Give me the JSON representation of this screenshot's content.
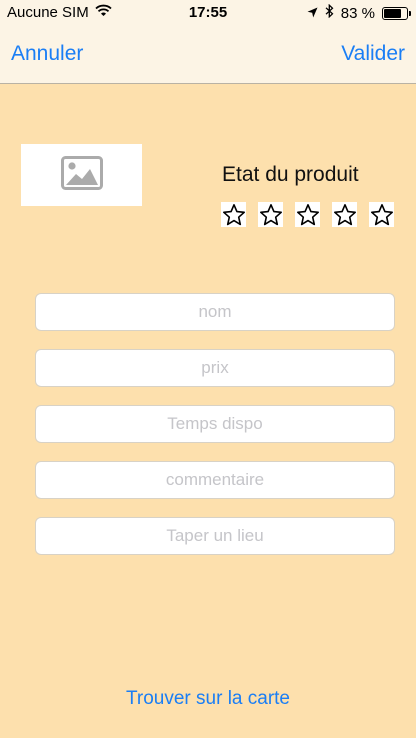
{
  "status_bar": {
    "carrier": "Aucune SIM",
    "time": "17:55",
    "battery_text": "83 %",
    "battery_level": 0.83
  },
  "nav": {
    "cancel_label": "Annuler",
    "validate_label": "Valider"
  },
  "product": {
    "image_icon": "image-placeholder-icon",
    "condition_label": "Etat du produit",
    "rating": 0,
    "max_rating": 5
  },
  "form": {
    "name_placeholder": "nom",
    "price_placeholder": "prix",
    "availability_placeholder": "Temps dispo",
    "comment_placeholder": "commentaire",
    "location_placeholder": "Taper un lieu"
  },
  "map_link_label": "Trouver sur la carte",
  "colors": {
    "accent": "#1a7ef5",
    "background": "#fde0ad",
    "bar": "#fcf4e5"
  }
}
